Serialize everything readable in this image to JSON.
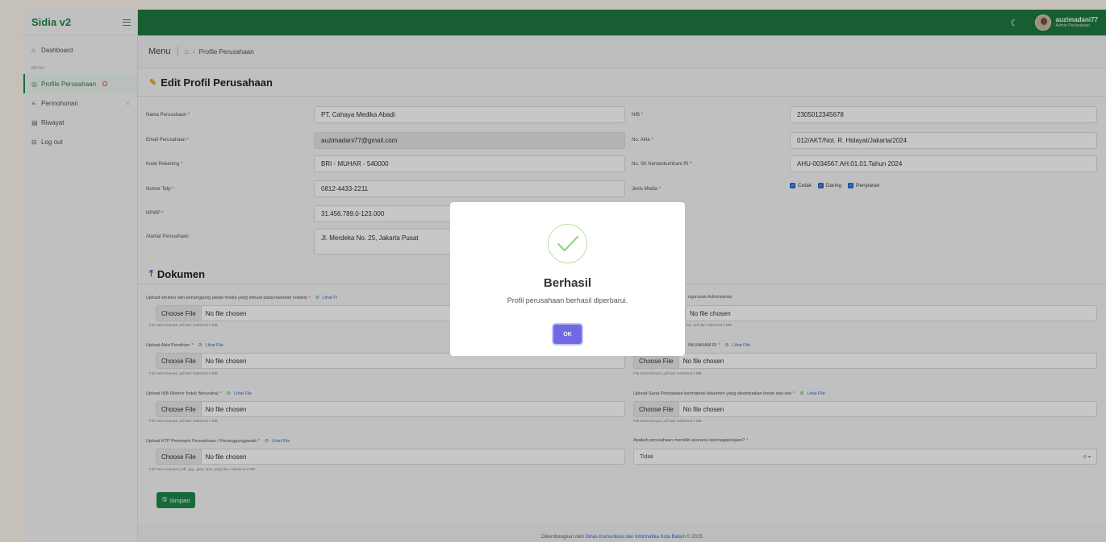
{
  "app": {
    "brand": "Sidia v2"
  },
  "sidebar": {
    "section_label": "MENU",
    "items": [
      {
        "label": "Dashboard",
        "icon": "home-icon"
      },
      {
        "label": "Profile Perusahaan",
        "icon": "company-icon"
      },
      {
        "label": "Permohonan",
        "icon": "list-icon"
      },
      {
        "label": "Riwayat",
        "icon": "history-icon"
      },
      {
        "label": "Log out",
        "icon": "logout-icon"
      }
    ]
  },
  "topbar": {
    "username": "auzimadani77",
    "role": "Admin Perusahaan"
  },
  "breadcrumb": {
    "menu": "Menu",
    "current": "Profile Perusahaan"
  },
  "form": {
    "title": "Edit Profil Perusahaan",
    "left": [
      {
        "label": "Nama Perusahaan",
        "value": "PT. Cahaya Medika Abadi"
      },
      {
        "label": "Email Perusahaan",
        "value": "auzimadani77@gmail.com"
      },
      {
        "label": "Kode Rekening",
        "value": "BRI - MUHAR - 540000"
      },
      {
        "label": "Nomor Telp",
        "value": "0812-4433-2211"
      },
      {
        "label": "NPWP",
        "value": "31.456.789.0-123.000"
      },
      {
        "label": "Alamat Perusahaan",
        "value": "Jl. Merdeka No. 25, Jakarta Pusat"
      }
    ],
    "right": [
      {
        "label": "NIB",
        "value": "2305012345678"
      },
      {
        "label": "No. Akta",
        "value": "012/AKT/Not. R. Hidayat/Jakarta/2024"
      },
      {
        "label": "No. SK Kemenkumham RI",
        "value": "AHU-0034567.AH.01.01.Tahun 2024"
      },
      {
        "label": "Jenis Media"
      }
    ],
    "media_options": [
      "Cetak",
      "Daring",
      "Penyiaran"
    ]
  },
  "dokumen": {
    "title": "Dokumen",
    "choose_label": "Choose File",
    "no_file": "No file chosen",
    "lihat": "Lihat File",
    "hint_pdf": "File harus berupa .pdf dan maksimal 2 MB.",
    "hint_img": "File harus berupa (.pdf, .jpg, .jpeg, atau .png) dan maksimal 2 MB.",
    "hint_right_1": "tau .pdf dan maksimal 2 MB.",
    "left": [
      {
        "label": "Upload struktur dan penanggung jawab media yang dimuat pada halaman redaksi",
        "lihat": "Lihat Fi"
      },
      {
        "label": "Upload Akta Pendirian"
      },
      {
        "label": "Upload NIB (Nomor Induk Berusaha)"
      },
      {
        "label": "Upload KTP Pemimpin Perusahaan / Penanggungjawab"
      }
    ],
    "right": [
      {
        "label": "ngurusan Administrasi"
      },
      {
        "label": "NKUMHAM RI"
      },
      {
        "label": "Upload Surat Pernyataan bermaterai dokumen yang disampaikan benar dan sah"
      }
    ],
    "asuransi_label": "Apakah perusahaan memiliki asuransi ketenagakerjaan?",
    "asuransi_value": "Tidak",
    "save_label": "Simpan"
  },
  "footer": {
    "prefix": "Dikembangkan oleh",
    "link": "Dinas Komunikasi dan Informatika Kota Batam",
    "suffix": "© 2025"
  },
  "modal": {
    "title": "Berhasil",
    "message": "Profil perusahaan berhasil diperbarui.",
    "ok_label": "OK"
  },
  "colors": {
    "primary": "#1e7a42",
    "accent": "#2f6bd6",
    "ok_button": "#7169e2",
    "required": "#e04040"
  }
}
